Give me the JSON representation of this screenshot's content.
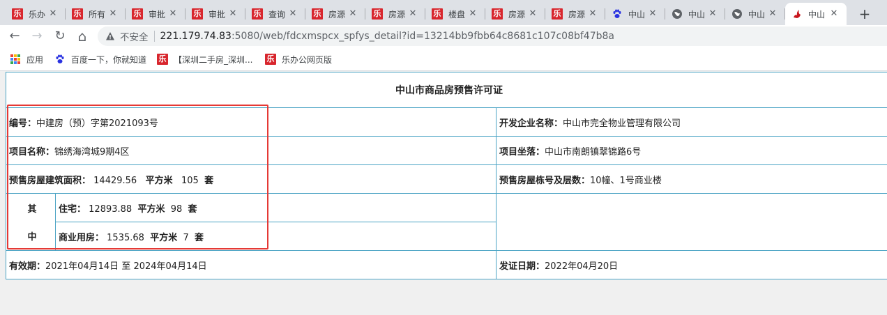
{
  "tabs": [
    {
      "title": "乐办",
      "favicon": "le"
    },
    {
      "title": "所有",
      "favicon": "le"
    },
    {
      "title": "审批",
      "favicon": "le"
    },
    {
      "title": "审批",
      "favicon": "le"
    },
    {
      "title": "查询",
      "favicon": "le"
    },
    {
      "title": "房源",
      "favicon": "le"
    },
    {
      "title": "房源",
      "favicon": "le"
    },
    {
      "title": "楼盘",
      "favicon": "le"
    },
    {
      "title": "房源",
      "favicon": "le"
    },
    {
      "title": "房源",
      "favicon": "le"
    },
    {
      "title": "中山",
      "favicon": "paw"
    },
    {
      "title": "中山",
      "favicon": "globe"
    },
    {
      "title": "中山",
      "favicon": "globe"
    },
    {
      "title": "中山",
      "favicon": "huo",
      "active": true
    }
  ],
  "tab_icons": {
    "le": "乐",
    "close": "✕",
    "new_tab": "+"
  },
  "toolbar": {
    "back_icon": "←",
    "forward_icon": "→",
    "reload_icon": "↻",
    "home_icon": "⌂",
    "security_label": "不安全",
    "url_host": "221.179.74.83",
    "url_rest": ":5080/web/fdcxmspcx_spfys_detail?id=13214bb9fbb64c8681c107c08bf47b8a"
  },
  "bookmarks": [
    {
      "label": "应用",
      "icon": "apps-icon"
    },
    {
      "label": "百度一下，你就知道",
      "icon": "paw-icon"
    },
    {
      "label": "【深圳二手房_深圳...",
      "icon": "le-icon"
    },
    {
      "label": "乐办公网页版",
      "icon": "le-icon"
    }
  ],
  "permit": {
    "title": "中山市商品房预售许可证",
    "number_label": "编号：",
    "number_value": "中建房（预）字第2021093号",
    "developer_label": "开发企业名称：",
    "developer_value": "中山市完全物业管理有限公司",
    "project_label": "项目名称：",
    "project_value": "锦绣海湾城9期4区",
    "location_label": "项目坐落：",
    "location_value": "中山市南朗镇翠锦路6号",
    "presale_area_label": "预售房屋建筑面积：",
    "presale_area_value": "14429.56",
    "presale_area_unit": "平方米",
    "presale_count": "105",
    "presale_count_unit": "套",
    "buildings_label": "预售房屋栋号及层数：",
    "buildings_value": "10幢、1号商业楼",
    "qi": "其",
    "zhong": "中",
    "residential_label": "住宅：",
    "residential_area": "12893.88",
    "residential_unit": "平方米",
    "residential_count": "98",
    "residential_count_unit": "套",
    "commercial_label": "商业用房：",
    "commercial_area": "1535.68",
    "commercial_unit": "平方米",
    "commercial_count": "7",
    "commercial_count_unit": "套",
    "validity_label": "有效期：",
    "validity_value": "2021年04月14日 至 2024年04月14日",
    "issue_date_label": "发证日期：",
    "issue_date_value": "2022年04月20日"
  },
  "colors": {
    "table_border": "#4aa3c4",
    "highlight_box": "#e53935",
    "favicon_le": "#d8262d"
  }
}
